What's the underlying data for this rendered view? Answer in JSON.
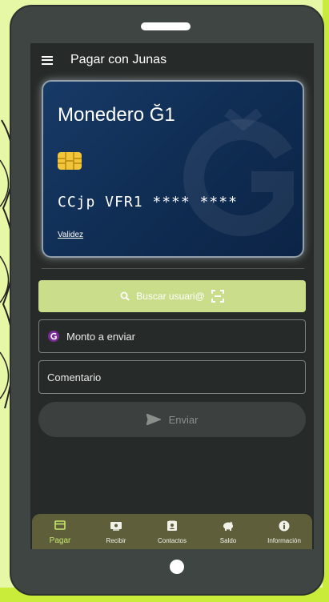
{
  "app_bar": {
    "title": "Pagar con Junas"
  },
  "wallet_card": {
    "title": "Monedero Ğ1",
    "number": "CCjp VFR1 **** ****",
    "validity_link": "Validez"
  },
  "search_button": {
    "label": "Buscar usuari@"
  },
  "amount_field": {
    "placeholder": "Monto a enviar"
  },
  "comment_field": {
    "placeholder": "Comentario"
  },
  "send_button": {
    "label": "Enviar"
  },
  "bottom_nav": {
    "items": [
      {
        "label": "Pagar",
        "icon": "credit-card-icon",
        "active": true
      },
      {
        "label": "Recibir",
        "icon": "receive-icon",
        "active": false
      },
      {
        "label": "Contactos",
        "icon": "contacts-icon",
        "active": false
      },
      {
        "label": "Saldo",
        "icon": "piggy-bank-icon",
        "active": false
      },
      {
        "label": "Información",
        "icon": "info-icon",
        "active": false
      }
    ]
  },
  "colors": {
    "accent": "#c9dd8a",
    "active_nav": "#c6e66b",
    "card_blue": "#173a66",
    "background_lime": "#e6f7a6"
  }
}
